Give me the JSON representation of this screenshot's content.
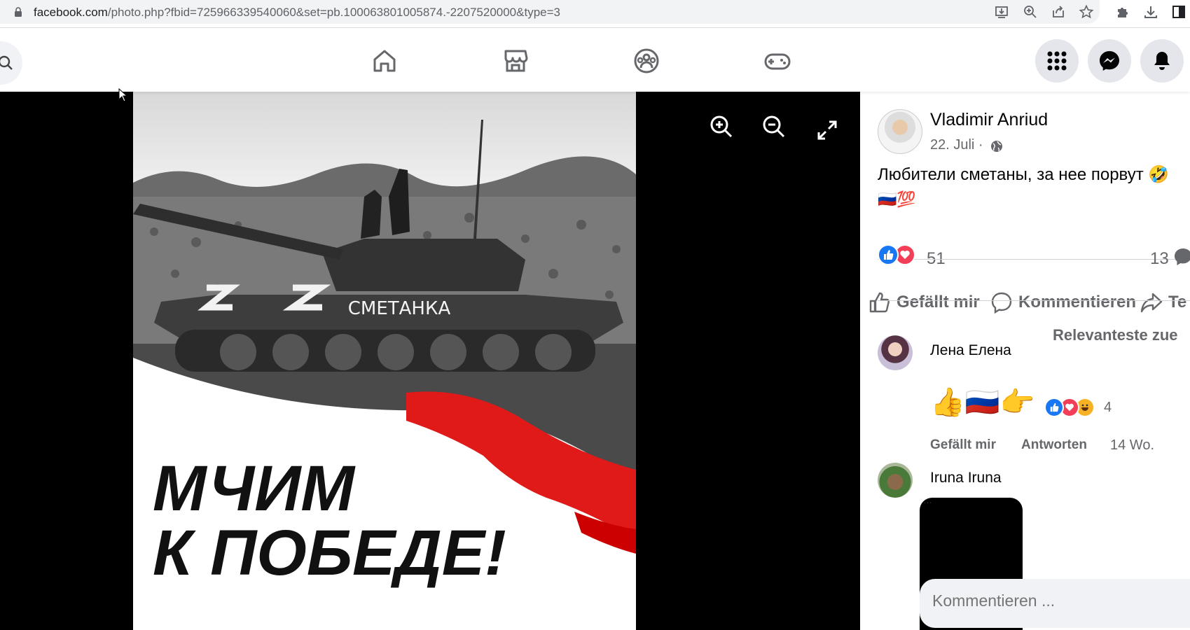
{
  "browser": {
    "url_host": "facebook.com",
    "url_rest": "/photo.php?fbid=725966339540060&set=pb.100063801005874.-2207520000&type=3",
    "icons": [
      "install-icon",
      "zoom-icon",
      "share-icon",
      "bookmark-star-icon",
      "extensions-icon",
      "download-icon",
      "sidebar-icon"
    ]
  },
  "fbnav": {
    "icons": [
      "home-icon",
      "marketplace-icon",
      "groups-icon",
      "gaming-icon"
    ],
    "right_buttons": [
      "menu-grid-icon",
      "messenger-icon",
      "notifications-bell-icon"
    ]
  },
  "viewer": {
    "photo_text_tank": "СМЕТАНКА",
    "photo_slogan_line1": "МЧИМ",
    "photo_slogan_line2": "К ПОБЕДЕ!",
    "controls": [
      "zoom-in-icon",
      "zoom-out-icon",
      "fullscreen-icon"
    ]
  },
  "post": {
    "author": "Vladimir Anriud",
    "date": "22. Juli ·",
    "text": "Любители сметаны, за нее порвут 🤣",
    "emojis": "🇷🇺💯",
    "reaction_count": "51",
    "comment_count": "13",
    "actions": {
      "like": "Gefällt mir",
      "comment": "Kommentieren",
      "share": "Te"
    },
    "sort_label": "Relevanteste zue"
  },
  "comments": [
    {
      "author": "Лена Елена",
      "body": "👍🇷🇺👉",
      "reaction_count": "4",
      "like_label": "Gefällt mir",
      "reply_label": "Antworten",
      "time": "14 Wo."
    },
    {
      "author": "Iruna Iruna"
    }
  ],
  "composer": {
    "placeholder": "Kommentieren ..."
  },
  "colors": {
    "fb_blue": "#1877f2",
    "love_red": "#f33e58",
    "haha_yellow": "#f7b125",
    "gray_text": "#65676b"
  }
}
